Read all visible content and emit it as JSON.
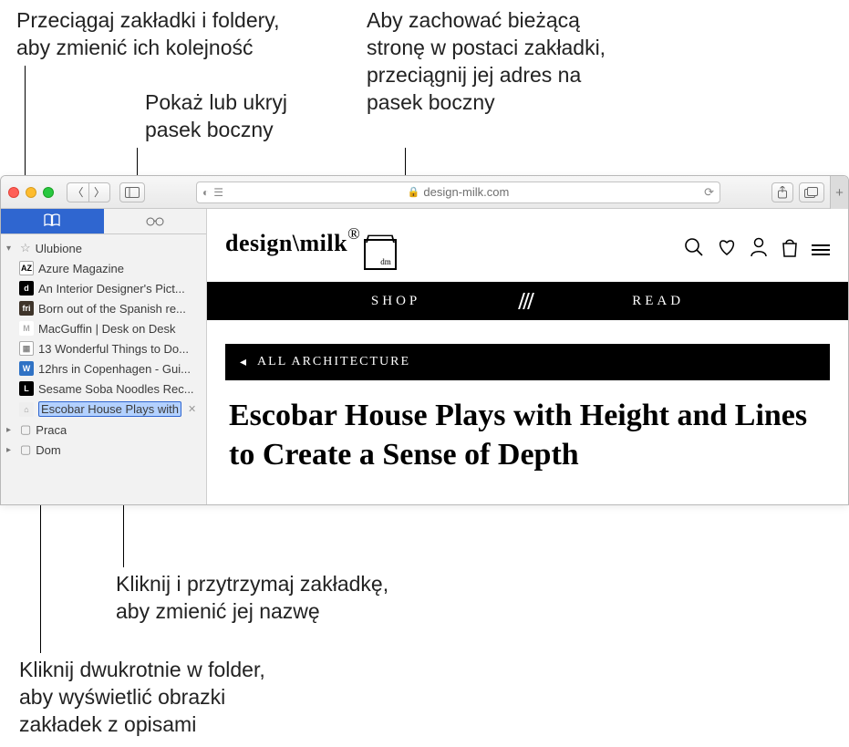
{
  "callouts": {
    "drag_reorder": "Przeciągaj zakładki i foldery,\naby zmienić ich kolejność",
    "toggle_sidebar": "Pokaż lub ukryj\npasek boczny",
    "drag_to_save": "Aby zachować bieżącą\nstronę w postaci zakładki,\nprzeciągnij jej adres na\npasek boczny",
    "click_hold_rename": "Kliknij i przytrzymaj zakładkę,\naby zmienić jej nazwę",
    "dblclick_folder": "Kliknij dwukrotnie w folder,\naby wyświetlić obrazki\nzakładek z opisami"
  },
  "address_bar": {
    "domain": "design-milk.com"
  },
  "sidebar": {
    "favorites_label": "Ulubione",
    "items": [
      {
        "label": "Azure Magazine"
      },
      {
        "label": "An Interior Designer's Pict..."
      },
      {
        "label": "Born out of the Spanish re..."
      },
      {
        "label": "MacGuffin | Desk on Desk"
      },
      {
        "label": "13 Wonderful Things to Do..."
      },
      {
        "label": "12hrs in Copenhagen - Gui..."
      },
      {
        "label": "Sesame Soba Noodles Rec..."
      },
      {
        "label": "Escobar House Plays with "
      }
    ],
    "folder_praca": "Praca",
    "folder_dom": "Dom"
  },
  "page": {
    "brand": "design\\milk",
    "brand_mark": "dm",
    "nav_shop": "SHOP",
    "nav_read": "READ",
    "subnav": "ALL ARCHITECTURE",
    "headline": "Escobar House Plays with Height and Lines to Create a Sense of Depth"
  }
}
